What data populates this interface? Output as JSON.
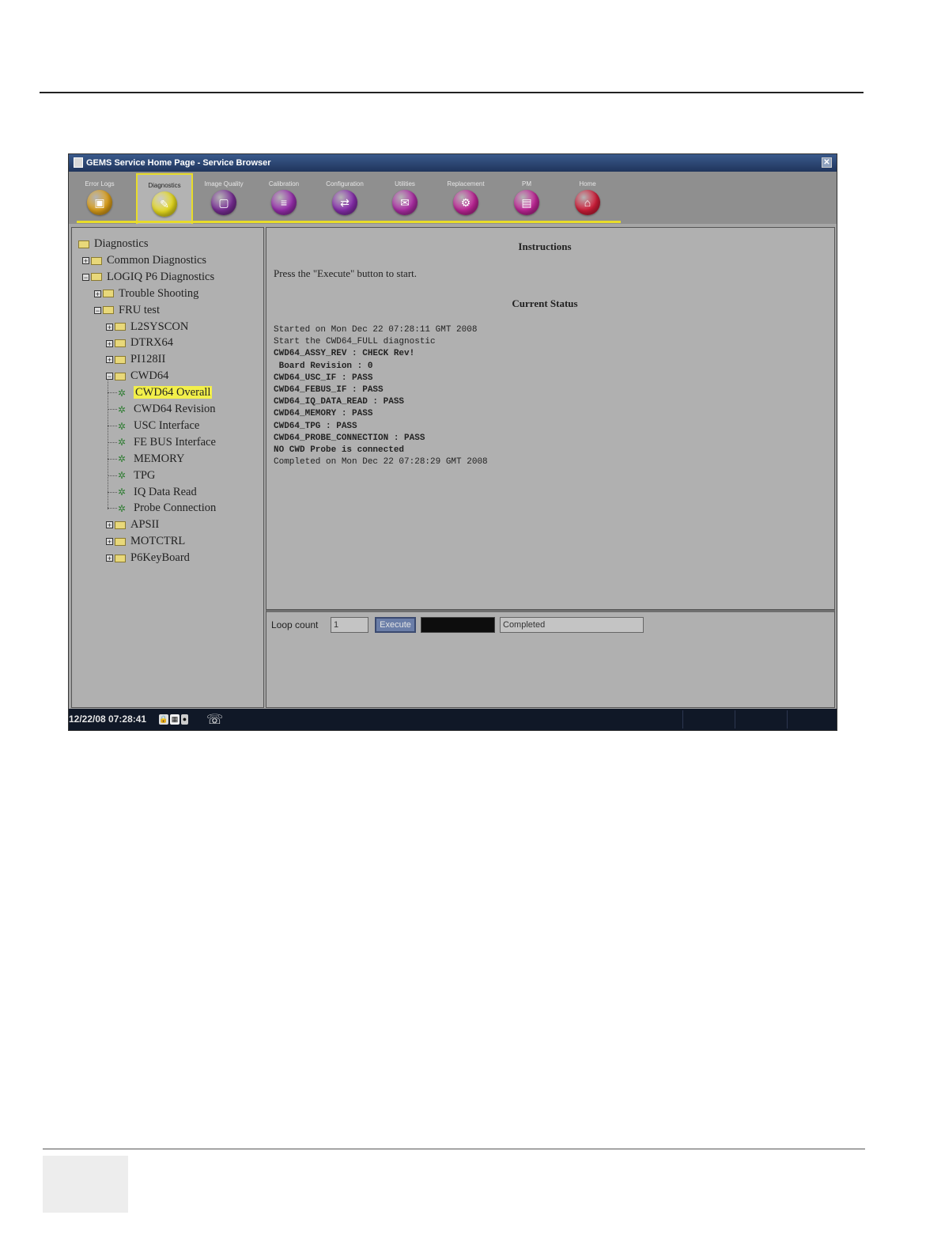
{
  "window": {
    "title": "GEMS Service Home Page - Service Browser",
    "close_glyph": "✕"
  },
  "tabs": [
    {
      "label": "Error Logs",
      "color": "#e0a21a",
      "icon": "log-icon",
      "glyph": "▣"
    },
    {
      "label": "Diagnostics",
      "color": "#e8dc1e",
      "icon": "stethoscope-icon",
      "glyph": "✎",
      "active": true
    },
    {
      "label": "Image Quality",
      "color": "#7b2f98",
      "icon": "monitor-icon",
      "glyph": "▢"
    },
    {
      "label": "Calibration",
      "color": "#9a2fb0",
      "icon": "calibration-icon",
      "glyph": "≡"
    },
    {
      "label": "Configuration",
      "color": "#8a2fb0",
      "icon": "configuration-icon",
      "glyph": "⇄"
    },
    {
      "label": "Utilities",
      "color": "#b02fa8",
      "icon": "utilities-icon",
      "glyph": "✉"
    },
    {
      "label": "Replacement",
      "color": "#c2279a",
      "icon": "replacement-icon",
      "glyph": "⚙"
    },
    {
      "label": "PM",
      "color": "#c4279a",
      "icon": "pm-icon",
      "glyph": "▤"
    },
    {
      "label": "Home",
      "color": "#d31e3a",
      "icon": "home-icon",
      "glyph": "⌂"
    }
  ],
  "tree": [
    {
      "label": "Diagnostics",
      "level": 0,
      "kind": "folder",
      "expander": ""
    },
    {
      "label": "Common Diagnostics",
      "level": 1,
      "kind": "folder",
      "expander": "+"
    },
    {
      "label": "LOGIQ P6 Diagnostics",
      "level": 1,
      "kind": "folder",
      "expander": "−"
    },
    {
      "label": "Trouble Shooting",
      "level": 2,
      "kind": "folder",
      "expander": "+"
    },
    {
      "label": "FRU test",
      "level": 2,
      "kind": "folder",
      "expander": "−"
    },
    {
      "label": "L2SYSCON",
      "level": 3,
      "kind": "folder",
      "expander": "+"
    },
    {
      "label": "DTRX64",
      "level": 3,
      "kind": "folder",
      "expander": "+"
    },
    {
      "label": "PI128II",
      "level": 3,
      "kind": "folder",
      "expander": "+"
    },
    {
      "label": "CWD64",
      "level": 3,
      "kind": "folder",
      "expander": "−"
    },
    {
      "label": "CWD64 Overall",
      "level": 4,
      "kind": "leaf",
      "selected": true
    },
    {
      "label": "CWD64 Revision",
      "level": 4,
      "kind": "leaf"
    },
    {
      "label": "USC Interface",
      "level": 4,
      "kind": "leaf"
    },
    {
      "label": "FE BUS Interface",
      "level": 4,
      "kind": "leaf"
    },
    {
      "label": "MEMORY",
      "level": 4,
      "kind": "leaf"
    },
    {
      "label": "TPG",
      "level": 4,
      "kind": "leaf"
    },
    {
      "label": "IQ Data Read",
      "level": 4,
      "kind": "leaf"
    },
    {
      "label": "Probe Connection",
      "level": 4,
      "kind": "leaf"
    },
    {
      "label": "APSII",
      "level": 3,
      "kind": "folder",
      "expander": "+"
    },
    {
      "label": "MOTCTRL",
      "level": 3,
      "kind": "folder",
      "expander": "+"
    },
    {
      "label": "P6KeyBoard",
      "level": 3,
      "kind": "folder",
      "expander": "+"
    }
  ],
  "main": {
    "instructions_heading": "Instructions",
    "instructions_text": "Press the \"Execute\" button to start.",
    "status_heading": "Current Status",
    "status_lines": [
      {
        "text": "Started on Mon Dec 22 07:28:11 GMT 2008",
        "bold": false
      },
      {
        "text": "Start the CWD64_FULL diagnostic",
        "bold": false
      },
      {
        "text": "CWD64_ASSY_REV : CHECK Rev!",
        "bold": true
      },
      {
        "text": " Board Revision : 0",
        "bold": true
      },
      {
        "text": "CWD64_USC_IF : PASS",
        "bold": true
      },
      {
        "text": "CWD64_FEBUS_IF : PASS",
        "bold": true
      },
      {
        "text": "CWD64_IQ_DATA_READ : PASS",
        "bold": true
      },
      {
        "text": "CWD64_MEMORY : PASS",
        "bold": true
      },
      {
        "text": "CWD64_TPG : PASS",
        "bold": true
      },
      {
        "text": "CWD64_PROBE_CONNECTION : PASS",
        "bold": true
      },
      {
        "text": "NO CWD Probe is connected",
        "bold": true
      },
      {
        "text": "Completed on Mon Dec 22 07:28:29 GMT 2008",
        "bold": false
      }
    ]
  },
  "controls": {
    "loop_count_label": "Loop count",
    "loop_count_value": "1",
    "execute_label": "Execute",
    "state_value": "Completed"
  },
  "statusbar": {
    "datetime": "12/22/08 07:28:41",
    "phone_glyph": "☏"
  }
}
